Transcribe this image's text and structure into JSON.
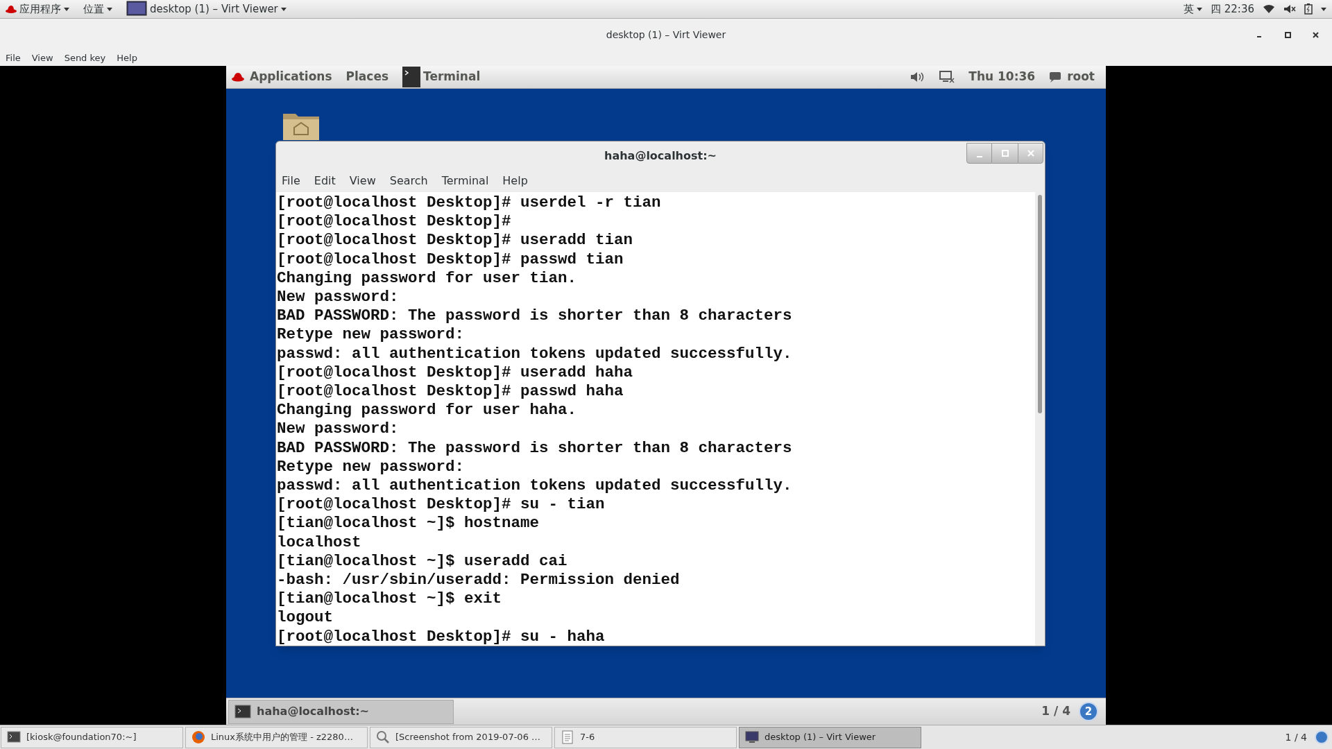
{
  "host_top_bar": {
    "apps_menu": "应用程序",
    "places_menu": "位置",
    "window_button": "desktop (1) – Virt Viewer",
    "input_method": "英",
    "clock": "四 22:36"
  },
  "viewer": {
    "title": "desktop (1) – Virt Viewer",
    "menus": [
      "File",
      "View",
      "Send key",
      "Help"
    ]
  },
  "guest_top_bar": {
    "applications": "Applications",
    "places": "Places",
    "active_app": "Terminal",
    "clock": "Thu 10:36",
    "user": "root"
  },
  "terminal": {
    "title": "haha@localhost:~",
    "menus": [
      "File",
      "Edit",
      "View",
      "Search",
      "Terminal",
      "Help"
    ],
    "lines": [
      "[root@localhost Desktop]# userdel -r tian",
      "[root@localhost Desktop]#",
      "[root@localhost Desktop]# useradd tian",
      "[root@localhost Desktop]# passwd tian",
      "Changing password for user tian.",
      "New password:",
      "BAD PASSWORD: The password is shorter than 8 characters",
      "Retype new password:",
      "passwd: all authentication tokens updated successfully.",
      "[root@localhost Desktop]# useradd haha",
      "[root@localhost Desktop]# passwd haha",
      "Changing password for user haha.",
      "New password:",
      "BAD PASSWORD: The password is shorter than 8 characters",
      "Retype new password:",
      "passwd: all authentication tokens updated successfully.",
      "[root@localhost Desktop]# su - tian",
      "[tian@localhost ~]$ hostname",
      "localhost",
      "[tian@localhost ~]$ useradd cai",
      "-bash: /usr/sbin/useradd: Permission denied",
      "[tian@localhost ~]$ exit",
      "logout",
      "[root@localhost Desktop]# su - haha"
    ]
  },
  "guest_bottom_bar": {
    "task": "haha@localhost:~",
    "workspace": "1 / 4",
    "workspace_badge": "2"
  },
  "host_taskbar": {
    "items": [
      {
        "kind": "terminal",
        "label": "[kiosk@foundation70:~]",
        "selected": false
      },
      {
        "kind": "browser",
        "label": "Linux系统中用户的管理 - z2280…",
        "selected": false
      },
      {
        "kind": "viewer",
        "label": "[Screenshot from 2019-07-06 …",
        "selected": false
      },
      {
        "kind": "document",
        "label": "7-6",
        "selected": false
      },
      {
        "kind": "monitor",
        "label": "desktop (1) – Virt Viewer",
        "selected": true
      }
    ],
    "workspace": "1 / 4"
  }
}
